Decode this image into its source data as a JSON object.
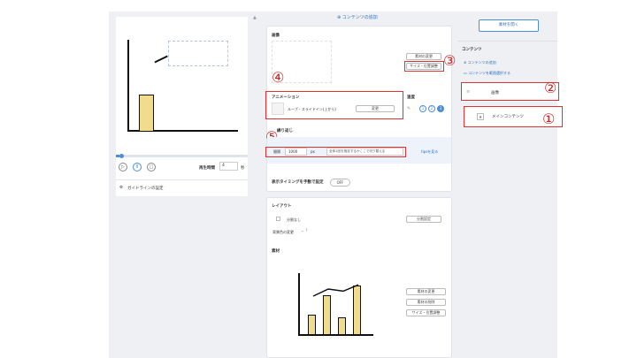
{
  "left": {
    "playback_label": "再生時間",
    "playback_value": "4",
    "playback_unit": "秒",
    "guide_label": "ガイドラインの設定",
    "controls": [
      "▷",
      "Ⅱ",
      "□"
    ]
  },
  "center": {
    "top_link": "コンテンツの追加",
    "image_section": {
      "title": "画像",
      "change_button": "素材の変更",
      "resize_button": "サイズ・位置調整"
    },
    "animation_section": {
      "title": "アニメーション",
      "value": "ループ・スライドイン(上から)",
      "change_button": "変更",
      "speed_label": "速度",
      "speed_options": [
        "1",
        "2",
        "3"
      ]
    },
    "repeat_section": {
      "title": "繰り返し",
      "interval_label": "間隔",
      "interval_value": "1000",
      "interval_unit": "px",
      "hint": "全体1回を指定するかここで切り替える",
      "tips_link": "tipsを見る"
    },
    "timing_section": {
      "title": "表示タイミングを手動で設定",
      "toggle_label": "OFF"
    },
    "layout_section": {
      "title": "レイアウト",
      "split_label": "分割なし",
      "split_button": "分割設定",
      "bg_color_label": "背景色の変更"
    },
    "material_section": {
      "title": "素材",
      "buttons": [
        "素材の変更",
        "素材の削除",
        "サイズ・位置調整"
      ]
    }
  },
  "right": {
    "open_material_button": "素材を開く",
    "contents_title": "コンテンツ",
    "add_content_link": "コンテンツの追加",
    "collect_link": "コンテンツを範囲選択する",
    "layers": [
      "画像",
      "メインコンテンツ"
    ]
  },
  "annotations": [
    "①",
    "②",
    "③",
    "④",
    "⑤"
  ],
  "preview_chart": {
    "type": "bar",
    "values": [
      1
    ]
  },
  "material_chart": {
    "type": "bar",
    "values": [
      2,
      4,
      1.7,
      5
    ],
    "line": [
      1,
      2,
      1.7,
      2.6
    ]
  }
}
